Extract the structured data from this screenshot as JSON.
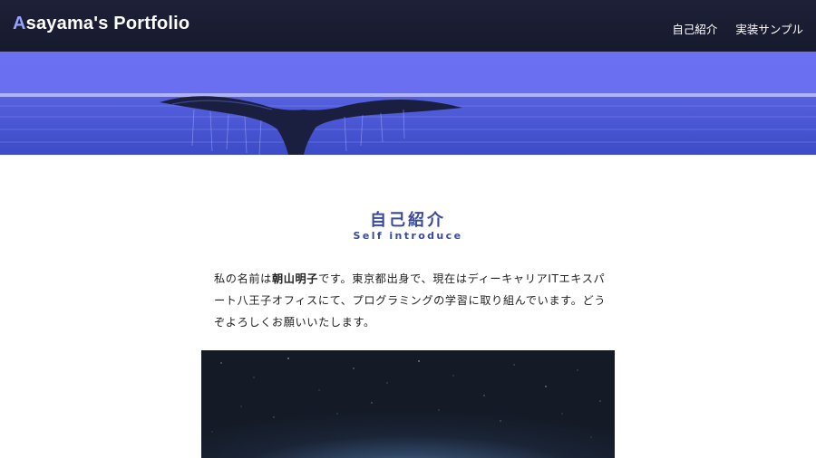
{
  "header": {
    "logo_first_letter": "A",
    "logo_rest": "sayama's Portfolio",
    "nav": [
      {
        "label": "自己紹介"
      },
      {
        "label": "実装サンプル"
      }
    ]
  },
  "section": {
    "title": "自己紹介",
    "subtitle": "Self introduce",
    "intro_before": "私の名前は",
    "intro_name": "朝山明子",
    "intro_after": "です。東京都出身で、現在はディーキャリアITエキスパート八王子オフィスにて、プログラミングの学習に取り組んでいます。どうぞよろしくお願いいたします。"
  },
  "colors": {
    "header_bg": "#1d2037",
    "logo_accent": "#9aa2ff",
    "title_color": "#3a4a9a",
    "hero_sea": "#5a62e4"
  }
}
